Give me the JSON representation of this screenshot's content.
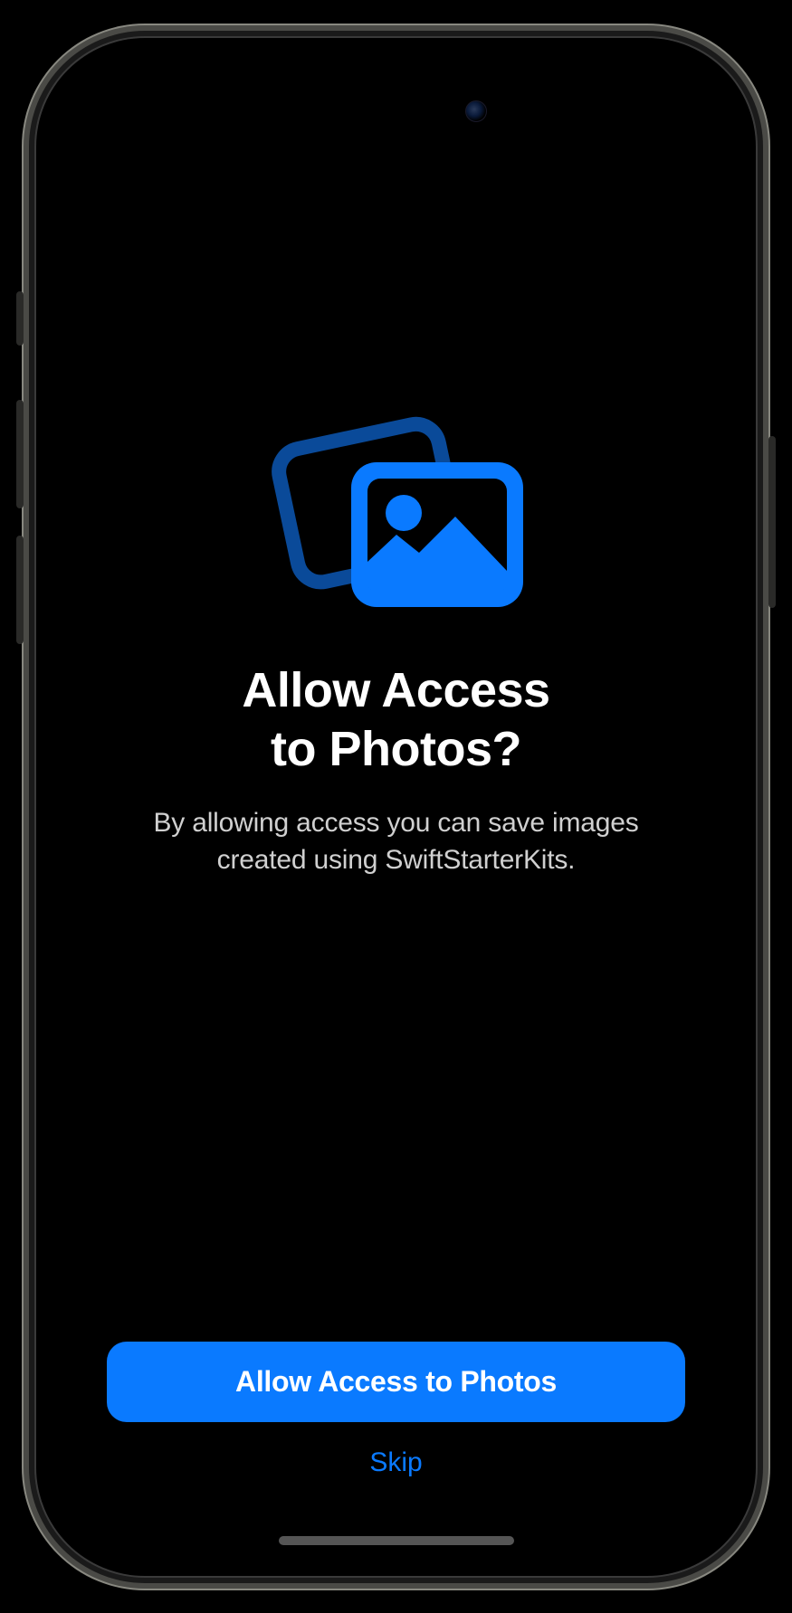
{
  "colors": {
    "accent": "#0a7aff",
    "bg": "#000000",
    "text_primary": "#ffffff",
    "text_secondary": "#d0d0d0"
  },
  "icon": {
    "name": "photos-stack-icon"
  },
  "content": {
    "title": "Allow Access\nto Photos?",
    "subtitle": "By allowing access you can save images created using SwiftStarterKits."
  },
  "actions": {
    "primary_label": "Allow Access to Photos",
    "secondary_label": "Skip"
  }
}
